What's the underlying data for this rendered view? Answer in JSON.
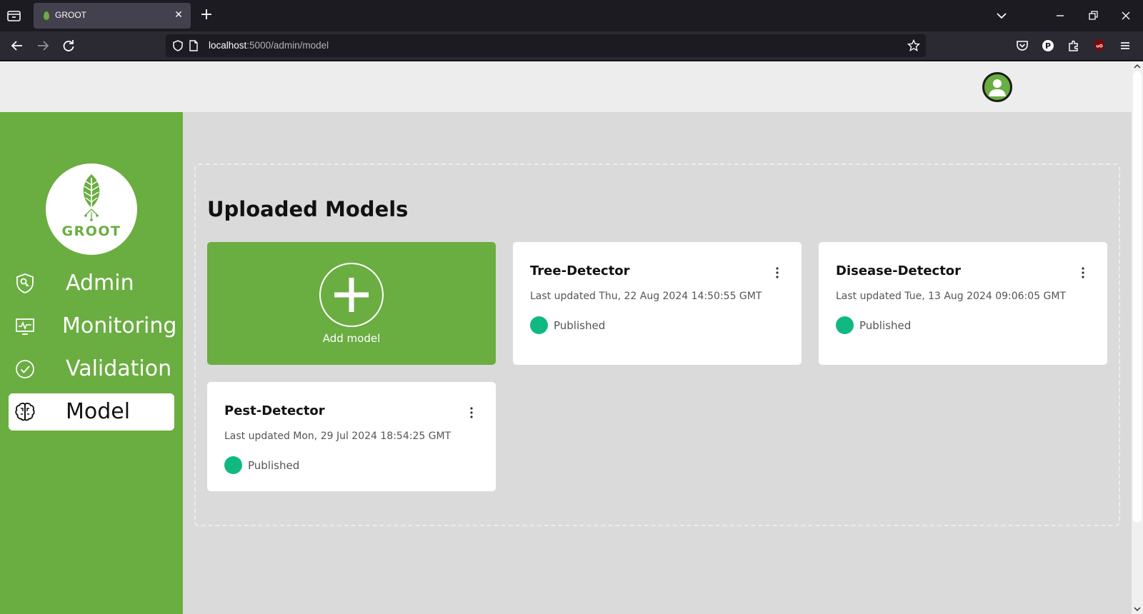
{
  "browser": {
    "tab_title": "GROOT",
    "url_host": "localhost",
    "url_rest": ":5000/admin/model"
  },
  "sidebar": {
    "logo_text": "GROOT",
    "items": [
      {
        "label": "Admin",
        "icon": "shield-key-icon"
      },
      {
        "label": "Monitoring",
        "icon": "monitor-chart-icon"
      },
      {
        "label": "Validation",
        "icon": "check-circle-icon"
      },
      {
        "label": "Model",
        "icon": "brain-icon",
        "active": true
      }
    ]
  },
  "main": {
    "title": "Uploaded Models",
    "add_label": "Add model",
    "models": [
      {
        "name": "Tree-Detector",
        "updated": "Last updated Thu, 22 Aug 2024 14:50:55 GMT",
        "status": "Published"
      },
      {
        "name": "Disease-Detector",
        "updated": "Last updated Tue, 13 Aug 2024 09:06:05 GMT",
        "status": "Published"
      },
      {
        "name": "Pest-Detector",
        "updated": "Last updated Mon, 29 Jul 2024 18:54:25 GMT",
        "status": "Published"
      }
    ]
  },
  "colors": {
    "brand_green": "#6aad41",
    "status_published": "#10b981",
    "page_bg": "#dadada"
  }
}
